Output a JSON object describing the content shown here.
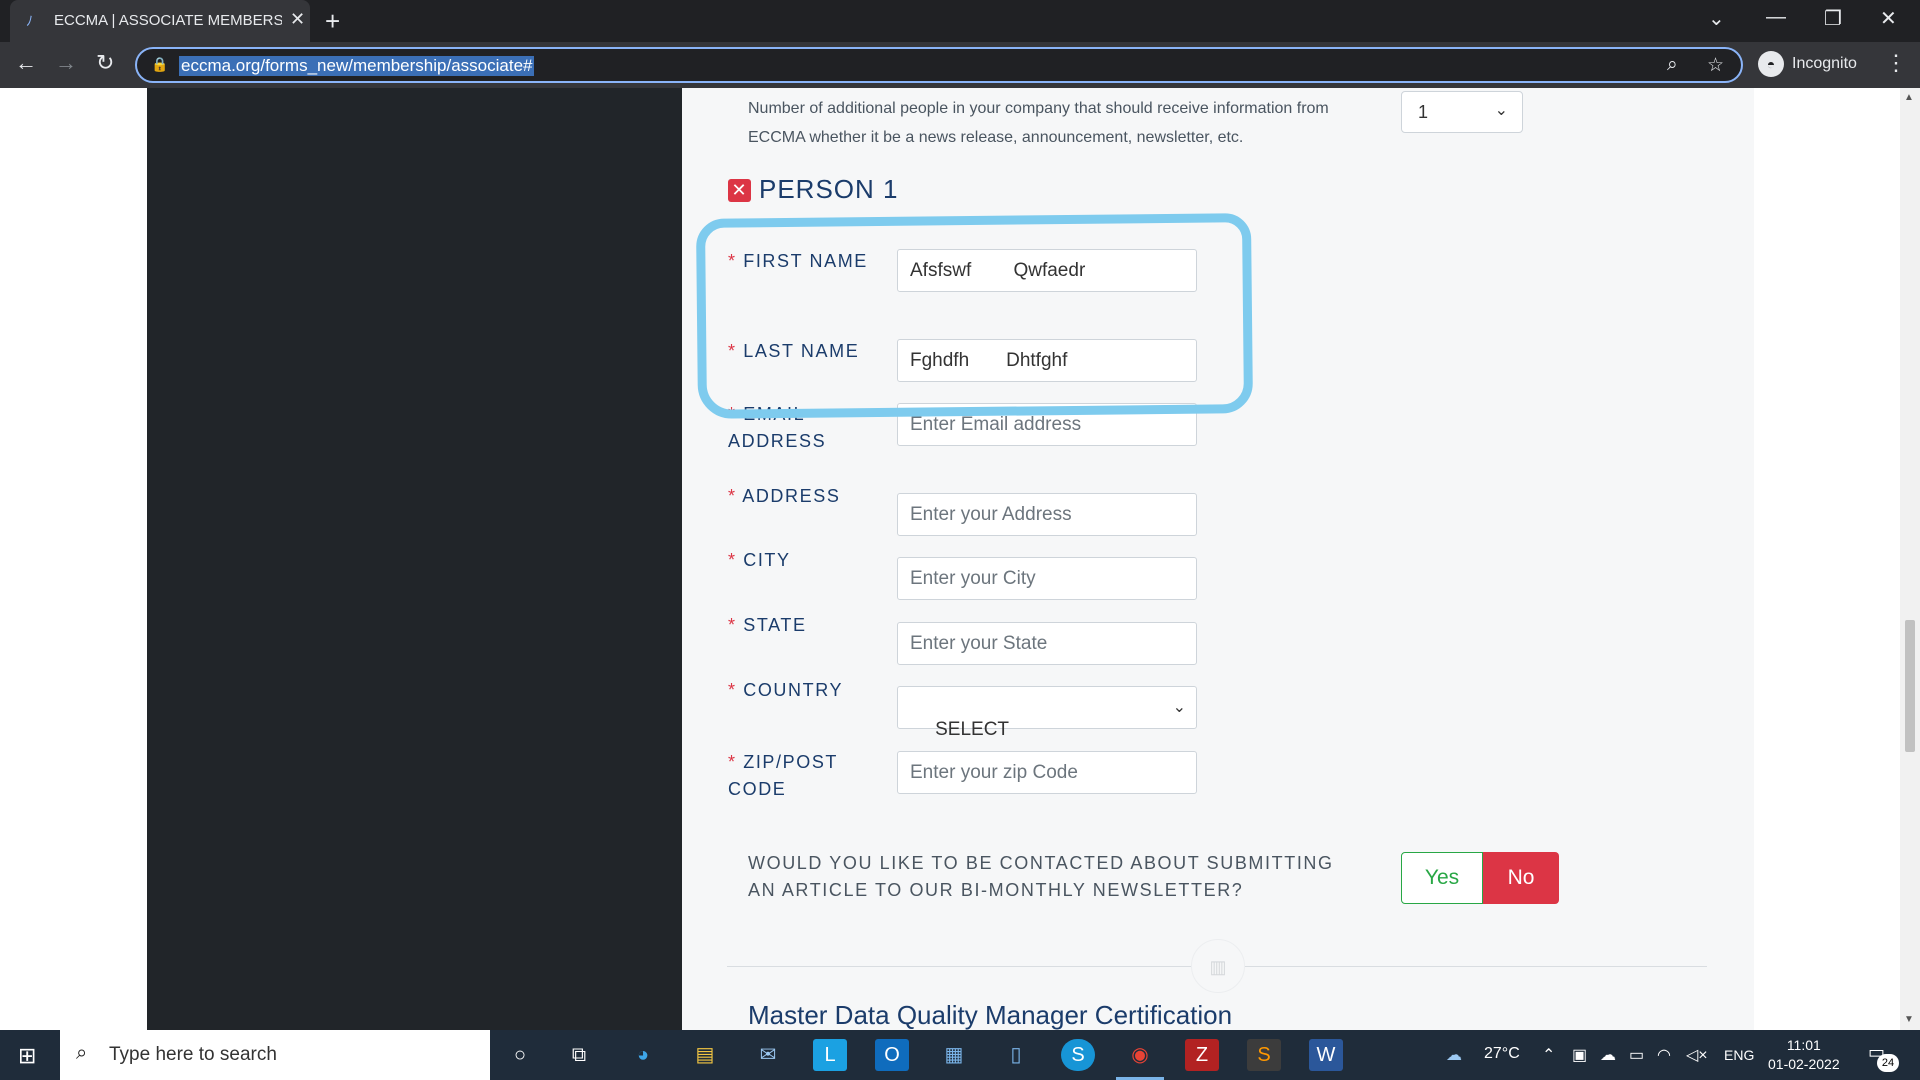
{
  "browser": {
    "tab_title": "ECCMA | ASSOCIATE MEMBERSHIP",
    "url": "eccma.org/forms_new/membership/associate#",
    "profile_label": "Incognito"
  },
  "form": {
    "additional_people_text": "Number of additional people in your company that should receive information from ECCMA whether it be a news release, announcement, newsletter, etc.",
    "additional_people_value": "1",
    "person_heading": "PERSON 1",
    "required_marker": "*",
    "fields": {
      "first_name": {
        "label": "FIRST NAME",
        "value": "Afsfswf        Qwfaedr"
      },
      "last_name": {
        "label": "LAST NAME",
        "value": "Fghdfh       Dhtfghf"
      },
      "email": {
        "label": "EMAIL ADDRESS",
        "placeholder": "Enter Email address"
      },
      "address": {
        "label": "ADDRESS",
        "placeholder": "Enter your Address"
      },
      "city": {
        "label": "CITY",
        "placeholder": "Enter your City"
      },
      "state": {
        "label": "STATE",
        "placeholder": "Enter your State"
      },
      "country": {
        "label": "COUNTRY",
        "value": "SELECT"
      },
      "zip": {
        "label": "ZIP/POST CODE",
        "placeholder": "Enter your zip Code"
      }
    },
    "newsletter_question": "WOULD YOU LIKE TO BE CONTACTED ABOUT SUBMITTING AN ARTICLE TO OUR BI-MONTHLY NEWSLETTER?",
    "yes_label": "Yes",
    "no_label": "No",
    "next_section_heading": "Master Data Quality Manager Certification"
  },
  "taskbar": {
    "search_placeholder": "Type here to search",
    "weather": "27°C",
    "language": "ENG",
    "time": "11:01",
    "date": "01-02-2022",
    "notification_count": "24"
  },
  "colors": {
    "accent_blue": "#1b3c6b",
    "required_red": "#dc3545",
    "yes_green": "#28a745",
    "highlight_stroke": "#7ecbee"
  }
}
